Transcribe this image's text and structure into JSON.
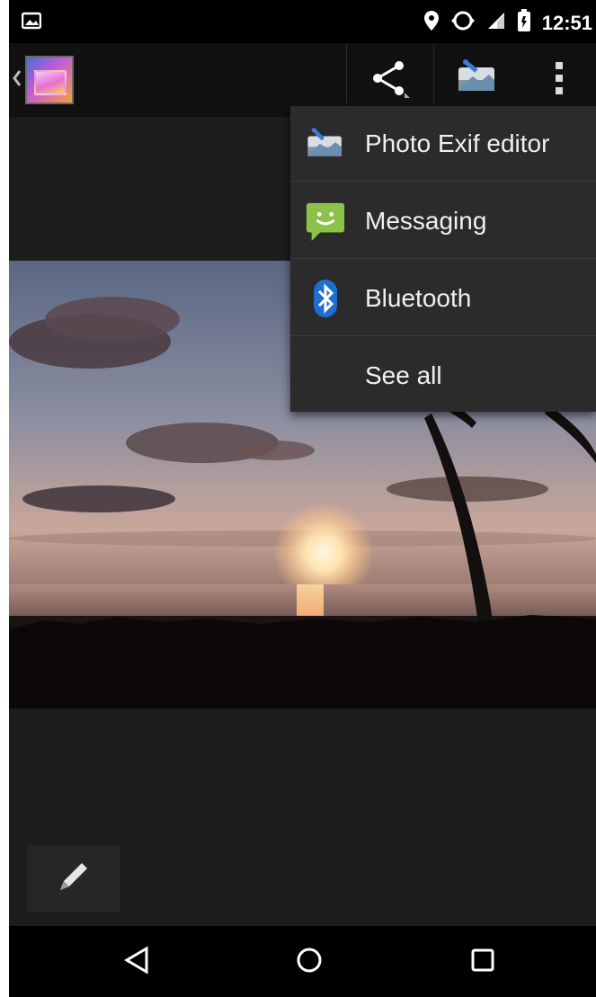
{
  "status_bar": {
    "time": "12:51",
    "icons": [
      "image-notification-icon",
      "location-icon",
      "data-sync-icon",
      "cell-signal-icon",
      "battery-icon"
    ]
  },
  "action_bar": {
    "back_icon": "chevron-left-icon",
    "app_icon": "gallery-app-icon",
    "actions": [
      "share-icon",
      "photo-exif-editor-icon",
      "overflow-menu-icon"
    ]
  },
  "share_menu": {
    "items": [
      {
        "label": "Photo Exif editor",
        "icon": "photo-exif-editor-icon"
      },
      {
        "label": "Messaging",
        "icon": "messaging-icon"
      },
      {
        "label": "Bluetooth",
        "icon": "bluetooth-icon"
      },
      {
        "label": "See all",
        "icon": ""
      }
    ]
  },
  "photo": {
    "subject": "sunset-palm-photo"
  },
  "edit": {
    "icon": "pencil-icon"
  },
  "nav_bar": {
    "buttons": [
      "back-triangle-icon",
      "home-circle-icon",
      "recents-square-icon"
    ]
  },
  "colors": {
    "menu_bg": "#2b2b2b",
    "screen_bg": "#1d1d1d",
    "messaging_green": "#8bc34a",
    "bluetooth_blue": "#1f6fd0"
  }
}
